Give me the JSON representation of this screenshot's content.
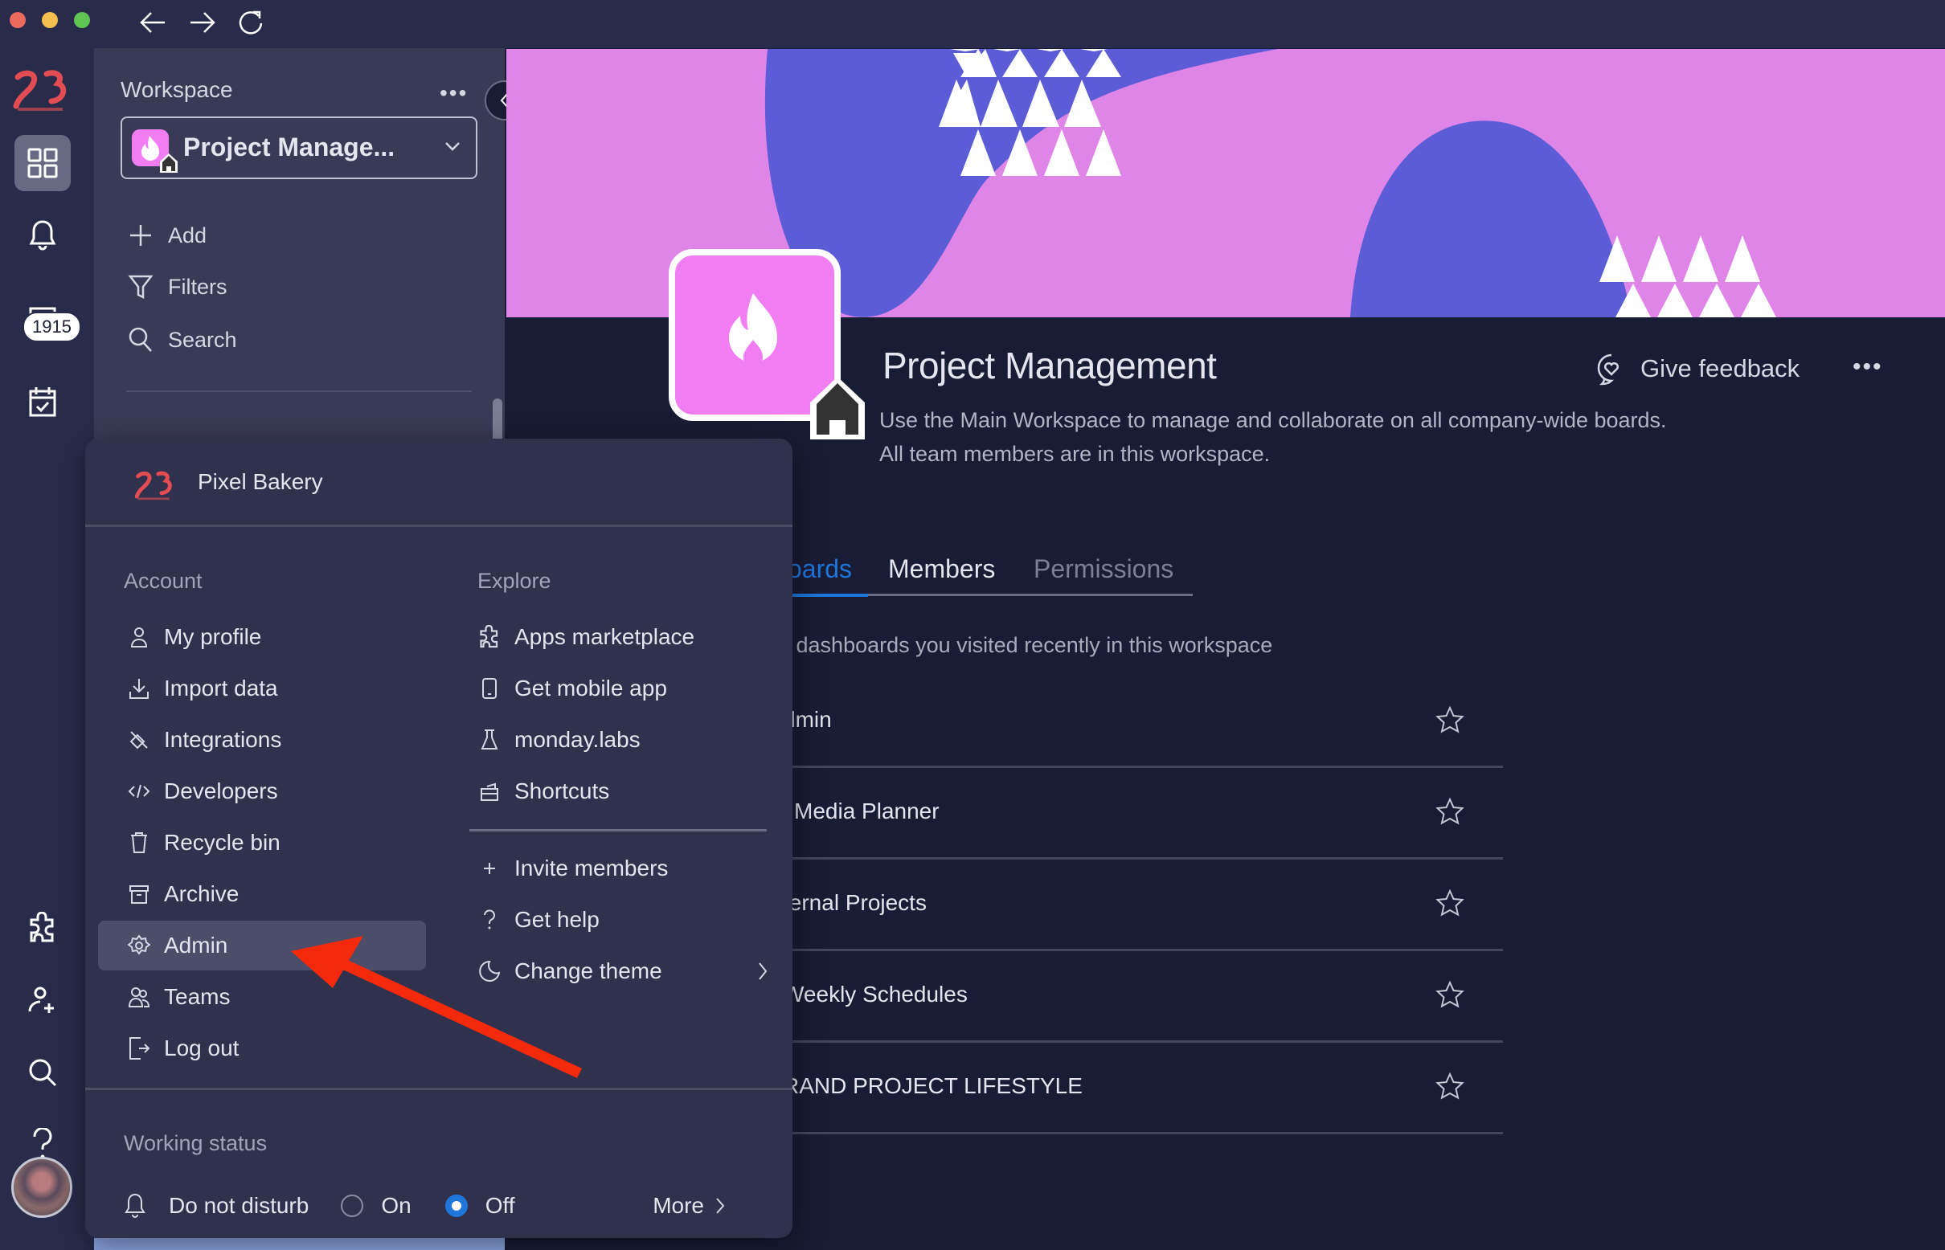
{
  "window": {
    "controls": [
      "close",
      "minimize",
      "maximize"
    ],
    "nav": [
      "back",
      "forward",
      "reload"
    ]
  },
  "rail": {
    "logo": "Pixel Bakery logo",
    "notification_badge": "1915",
    "items": [
      "workspaces",
      "notifications",
      "inbox",
      "my-work",
      "apps",
      "invite-members",
      "search",
      "help",
      "profile-avatar"
    ]
  },
  "workspace_panel": {
    "title": "Workspace",
    "more_label": "•••",
    "selected_workspace": "Project Manage...",
    "actions": [
      {
        "icon": "plus-icon",
        "label": "Add"
      },
      {
        "icon": "filter-icon",
        "label": "Filters"
      },
      {
        "icon": "search-icon",
        "label": "Search"
      }
    ]
  },
  "main": {
    "title": "Project Management",
    "description_line1": "Use the Main Workspace to manage and collaborate on all company-wide boards.",
    "description_line2": "All team members are in this workspace.",
    "feedback_label": "Give feedback",
    "more_label": "•••",
    "tabs": [
      {
        "label": "oards",
        "active": true
      },
      {
        "label": "Members",
        "active": false
      },
      {
        "label": "Permissions",
        "active": false
      }
    ],
    "recent_description": "d dashboards you visited recently in this workspace",
    "boards": [
      {
        "name": "dmin",
        "starred": false
      },
      {
        "name": "l Media Planner",
        "starred": false
      },
      {
        "name": "ternal Projects",
        "starred": false
      },
      {
        "name": " Weekly Schedules",
        "starred": false
      },
      {
        "name": "RAND PROJECT LIFESTYLE",
        "starred": false
      }
    ]
  },
  "account_menu": {
    "org_name": "Pixel Bakery",
    "account_section": "Account",
    "account_items": [
      {
        "icon": "user-icon",
        "label": "My profile"
      },
      {
        "icon": "download-icon",
        "label": "Import data"
      },
      {
        "icon": "integrations-icon",
        "label": "Integrations"
      },
      {
        "icon": "code-icon",
        "label": "Developers"
      },
      {
        "icon": "trash-icon",
        "label": "Recycle bin"
      },
      {
        "icon": "archive-icon",
        "label": "Archive"
      },
      {
        "icon": "gear-icon",
        "label": "Admin",
        "highlighted": true
      },
      {
        "icon": "team-icon",
        "label": "Teams"
      },
      {
        "icon": "logout-icon",
        "label": "Log out"
      }
    ],
    "explore_section": "Explore",
    "explore_items": [
      {
        "icon": "puzzle-icon",
        "label": "Apps marketplace"
      },
      {
        "icon": "mobile-icon",
        "label": "Get mobile app"
      },
      {
        "icon": "flask-icon",
        "label": "monday.labs"
      },
      {
        "icon": "keyboard-icon",
        "label": "Shortcuts"
      }
    ],
    "extra_items": [
      {
        "icon": "plus-icon",
        "label": "Invite members"
      },
      {
        "icon": "question-icon",
        "label": "Get help"
      },
      {
        "icon": "moon-icon",
        "label": "Change theme",
        "has_submenu": true
      }
    ],
    "working_status_label": "Working status",
    "do_not_disturb_label": "Do not disturb",
    "on_label": "On",
    "off_label": "Off",
    "dnd_selected": "Off",
    "more_label": "More"
  },
  "colors": {
    "accent": "#1f76db",
    "banner_pink": "#e085e8",
    "banner_blue": "#5b5cd6",
    "workspace_icon": "#f07ef2",
    "annotation_arrow": "#f52a0c"
  }
}
